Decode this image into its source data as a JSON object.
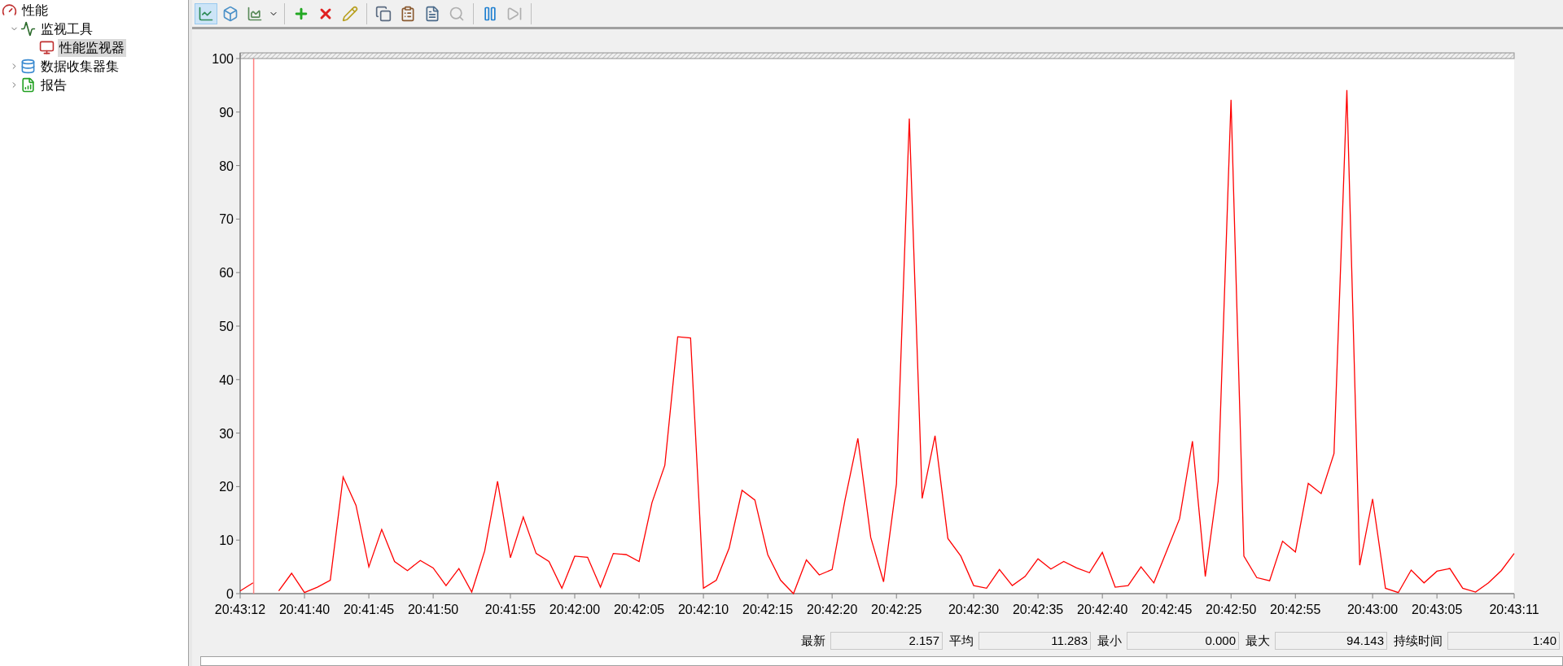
{
  "tree": [
    {
      "label": "性能",
      "kind": "root",
      "selected": false,
      "children": [
        {
          "label": "监视工具",
          "kind": "tools",
          "selected": false,
          "expanded": true,
          "children": [
            {
              "label": "性能监视器",
              "kind": "monitor",
              "selected": true
            }
          ]
        },
        {
          "label": "数据收集器集",
          "kind": "collector",
          "selected": false,
          "expanded": false
        },
        {
          "label": "报告",
          "kind": "reports",
          "selected": false,
          "expanded": false
        }
      ]
    }
  ],
  "toolbar_groups": [
    [
      {
        "kind": "line",
        "selected": true,
        "disabled": false
      },
      {
        "kind": "block",
        "selected": false,
        "disabled": false
      },
      {
        "kind": "report",
        "selected": false,
        "disabled": false
      },
      {
        "kind": "dropdown",
        "selected": false,
        "disabled": false
      }
    ],
    [
      {
        "kind": "add",
        "selected": false,
        "disabled": false
      },
      {
        "kind": "delete",
        "selected": false,
        "disabled": false
      },
      {
        "kind": "highlight",
        "selected": false,
        "disabled": false
      }
    ],
    [
      {
        "kind": "copy",
        "selected": false,
        "disabled": false
      },
      {
        "kind": "paste",
        "selected": false,
        "disabled": false
      },
      {
        "kind": "properties",
        "selected": false,
        "disabled": false
      },
      {
        "kind": "zoom",
        "selected": false,
        "disabled": true
      }
    ],
    [
      {
        "kind": "pause",
        "selected": false,
        "disabled": false
      },
      {
        "kind": "step",
        "selected": false,
        "disabled": true
      }
    ]
  ],
  "chart_data": {
    "type": "line",
    "categories": [
      "20:43:12",
      null,
      null,
      null,
      null,
      "20:41:40",
      null,
      null,
      null,
      null,
      "20:41:45",
      null,
      null,
      null,
      null,
      "20:41:50",
      null,
      null,
      null,
      null,
      null,
      "20:41:55",
      null,
      null,
      null,
      null,
      "20:42:00",
      null,
      null,
      null,
      null,
      "20:42:05",
      null,
      null,
      null,
      null,
      "20:42:10",
      null,
      null,
      null,
      null,
      "20:42:15",
      null,
      null,
      null,
      null,
      "20:42:20",
      null,
      null,
      null,
      null,
      "20:42:25",
      null,
      null,
      null,
      null,
      null,
      "20:42:30",
      null,
      null,
      null,
      null,
      "20:42:35",
      null,
      null,
      null,
      null,
      "20:42:40",
      null,
      null,
      null,
      null,
      "20:42:45",
      null,
      null,
      null,
      null,
      "20:42:50",
      null,
      null,
      null,
      null,
      "20:42:55",
      null,
      null,
      null,
      null,
      null,
      "20:43:00",
      null,
      null,
      null,
      null,
      "20:43:05",
      null,
      null,
      null,
      null,
      null,
      "20:43:11"
    ],
    "ylim": [
      0,
      100
    ],
    "yticks": [
      0,
      10,
      20,
      30,
      40,
      50,
      60,
      70,
      80,
      90,
      100
    ],
    "series": [
      {
        "color": "#ff0000",
        "values": [
          0.5,
          2,
          null,
          0.5,
          3.8,
          0.2,
          1.2,
          2.5,
          21.8,
          16.5,
          5,
          12,
          6,
          4.3,
          6.2,
          4.8,
          1.5,
          4.7,
          0.3,
          8,
          21,
          6.7,
          14.3,
          7.5,
          6,
          1,
          7,
          6.8,
          1.2,
          7.5,
          7.3,
          6,
          17,
          24,
          48,
          47.8,
          1,
          2.5,
          8.5,
          19.3,
          17.5,
          7.3,
          2.5,
          0,
          6.3,
          3.5,
          4.5,
          17.5,
          29,
          10.5,
          2.2,
          20.5,
          88.8,
          17.8,
          29.5,
          10.3,
          7,
          1.5,
          1,
          4.5,
          1.5,
          3.2,
          6.5,
          4.6,
          6,
          4.8,
          3.9,
          7.7,
          1.2,
          1.5,
          5,
          2,
          8,
          14,
          28.5,
          3.2,
          21,
          92.3,
          7,
          3,
          2.4,
          9.8,
          7.8,
          20.6,
          18.7,
          26.2,
          94.1,
          5.3,
          17.7,
          1,
          0.2,
          4.4,
          2,
          4.2,
          4.7,
          1,
          0.3,
          2,
          4.3,
          7.5
        ]
      }
    ]
  },
  "stats": [
    {
      "label": "最新",
      "value": "2.157"
    },
    {
      "label": "平均",
      "value": "11.283"
    },
    {
      "label": "最小",
      "value": "0.000"
    },
    {
      "label": "最大",
      "value": "94.143"
    },
    {
      "label": "持续时间",
      "value": "1:40"
    }
  ]
}
